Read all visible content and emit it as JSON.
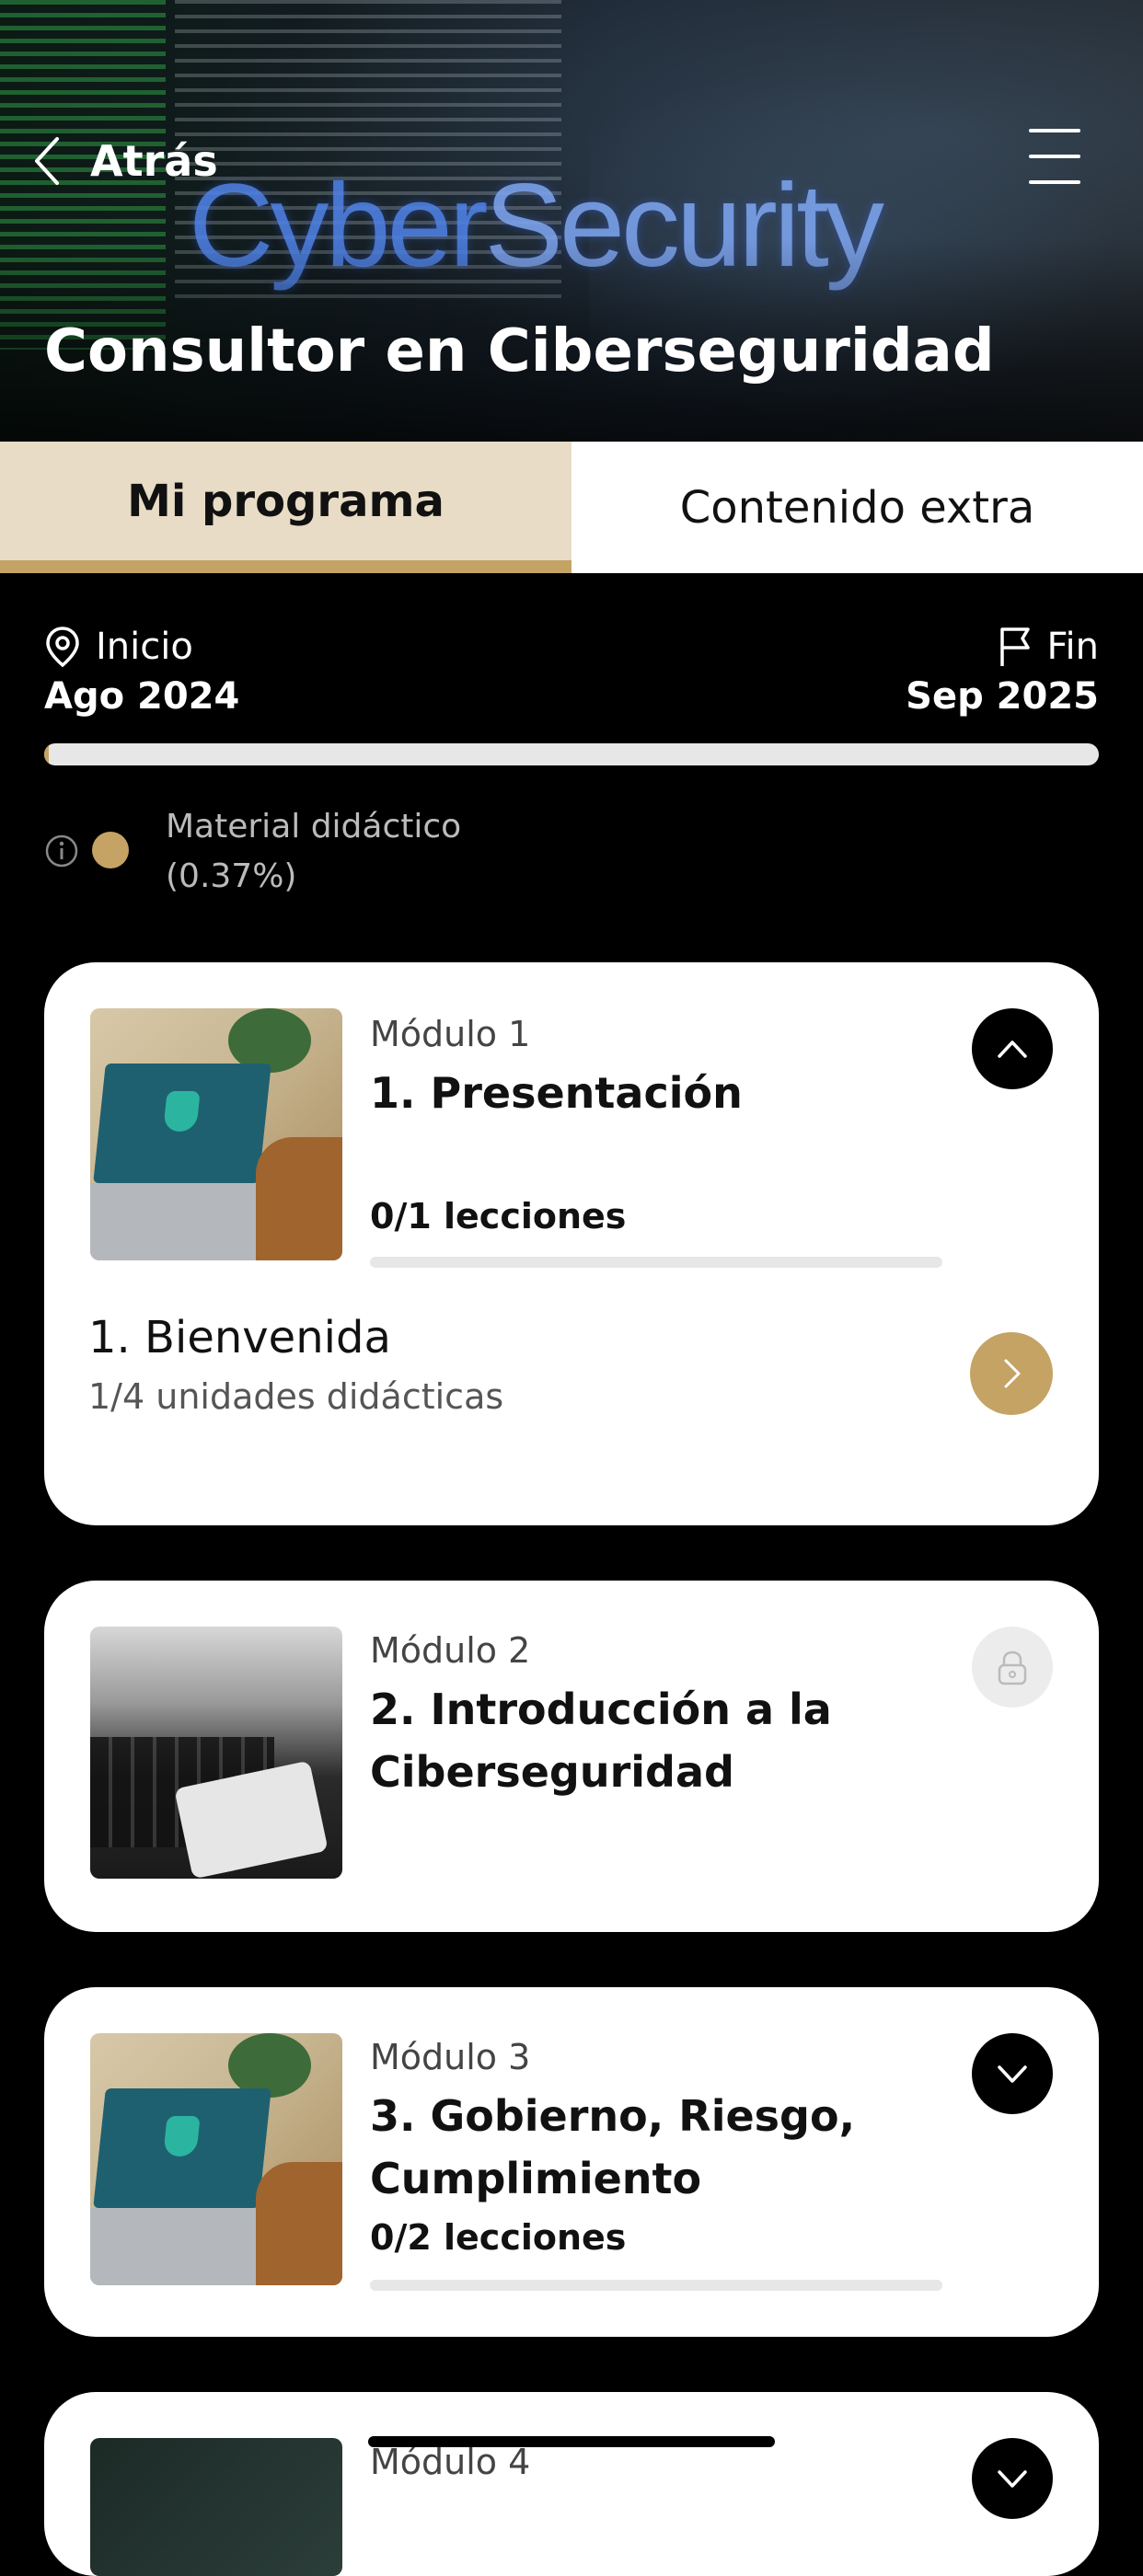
{
  "header": {
    "back_label": "Atrás",
    "brand_part1": "Cyber",
    "brand_part2": "Security",
    "title": "Consultor en Ciberseguridad"
  },
  "tabs": [
    {
      "label": "Mi programa",
      "active": true
    },
    {
      "label": "Contenido extra",
      "active": false
    }
  ],
  "program": {
    "start_label": "Inicio",
    "start_date": "Ago 2024",
    "end_label": "Fin",
    "end_date": "Sep 2025",
    "progress_percent": 0.37,
    "material_label": "Material didáctico",
    "material_value": "(0.37%)"
  },
  "modules": [
    {
      "label": "Módulo 1",
      "title": "1. Presentación",
      "lessons": "0/1 lecciones",
      "expanded": true,
      "unit_title": "1. Bienvenida",
      "unit_sub": "1/4 unidades didácticas"
    },
    {
      "label": "Módulo 2",
      "title": "2. Introducción a la Ciberseguridad",
      "locked": true
    },
    {
      "label": "Módulo 3",
      "title": "3. Gobierno, Riesgo, Cumplimiento",
      "lessons": "0/2 lecciones",
      "expanded": false
    },
    {
      "label": "Módulo 4"
    }
  ],
  "colors": {
    "accent": "#c4a364",
    "tab_active_bg": "#e8dcc6",
    "background": "#000000"
  }
}
